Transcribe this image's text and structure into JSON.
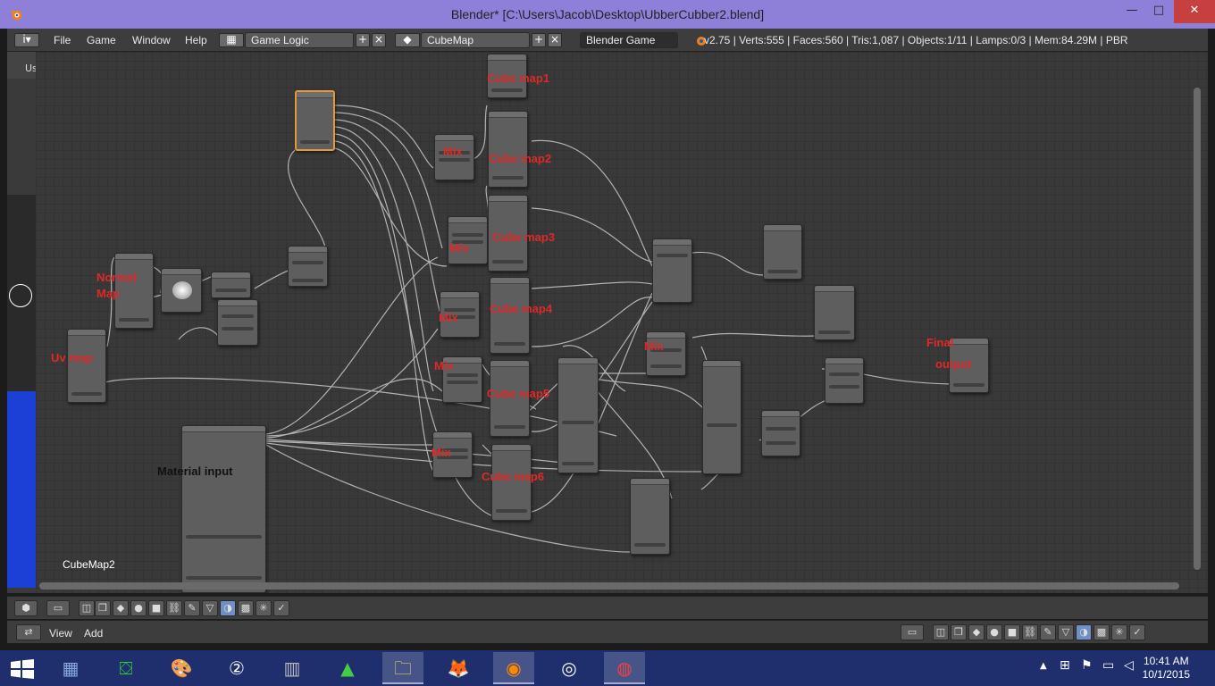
{
  "window": {
    "title": "Blender* [C:\\Users\\Jacob\\Desktop\\UbberCubber2.blend]",
    "min": "—",
    "max": "□",
    "close": "✕"
  },
  "menu": [
    "File",
    "Game",
    "Window",
    "Help"
  ],
  "screen_layout": "Game Logic",
  "scene": "CubeMap",
  "engine": "Blender Game",
  "stats": "v2.75 | Verts:555 | Faces:560 | Tris:1,087 | Objects:1/11 | Lamps:0/3 | Mem:84.29M | PBR",
  "editor": {
    "view_name": "CubeMap2",
    "left_header": "Us"
  },
  "labels": {
    "cube1": "Cube map1",
    "cube2": "Cube map2",
    "cube3": "Cube map3",
    "cube4": "Cube map4",
    "cube5": "Cube map5",
    "cube6": "Cube map6",
    "mix1": "Mix",
    "mix2": "Mix",
    "mix3": "Mix",
    "mix4": "Mix",
    "mix5": "Mix",
    "mix6": "Mix",
    "normal_a": "Normal",
    "normal_b": "Map",
    "uv": "Uv map",
    "final_a": "Final",
    "final_b": "output",
    "material": "Material input"
  },
  "bottom_menu": [
    "View",
    "Add"
  ],
  "clock": {
    "time": "10:41 AM",
    "date": "10/1/2015"
  },
  "colors": {
    "title_bar": "#8e80d9",
    "label": "#e02828",
    "taskbar": "#1f2f6e",
    "close": "#c74040",
    "selected_node": "#e09a3c"
  }
}
